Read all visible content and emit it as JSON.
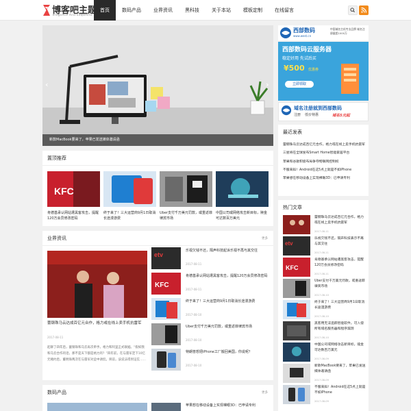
{
  "header": {
    "logo_text": "博客吧主题",
    "logo_sub": "Elegance And Exquisite",
    "nav": [
      "首页",
      "数码产品",
      "业界资讯",
      "黑科技",
      "关于本站",
      "模板定制",
      "在线留言"
    ],
    "active_nav_index": 0,
    "accent_color": "#e94141",
    "rss_color": "#f28b1b",
    "icons": [
      "search-icon",
      "rss-icon"
    ]
  },
  "slider": {
    "caption": "新款MacBook要来了，苹果已发送媒体邀请函",
    "prev": "‹",
    "next": "›"
  },
  "featured": {
    "title": "置顶推荐",
    "items": [
      "肯德基承认网站遭黑客攻击，提醒120万会员修改密码",
      "终于来了！三大运营商9月1日取消长途漫游费",
      "Uber支付千万美元罚款，或重返菲律宾市场",
      "中国公司或网络攻击新目标，赎金可达数百万美元"
    ]
  },
  "industry": {
    "title": "业界资讯",
    "more": "更多",
    "big": {
      "title": "蕾钢珠马云达成百亿元合作，格力或在线上卖手机抗雷军",
      "date": "2017-08-11",
      "excerpt": "起聊了四年后，蕾钢珠和马云再次牵手。格力和阿里正式联姻。“假如我和马云合作的话，那不是天下都是格力的？”四年前，在与雷军定下10亿元赌约后，董明珠两次在与雷军对垒中调侃。目前，该说法得到证实……"
    },
    "list": [
      {
        "title": "乐视欠钱不还，隔声科技起诉乐视不再与其交往",
        "date": "2017-08-11"
      },
      {
        "title": "肯德基承认网站遭黑客攻击，提醒120万会员修改密码",
        "date": "2017-08-11"
      },
      {
        "title": "终于来了！三大运营商9月1日取消长途漫游费",
        "date": "2017-08-10"
      },
      {
        "title": "Uber支付千万美元罚款，或重返菲律宾市场",
        "date": "2017-08-10"
      },
      {
        "title": "特朗普想把iPhone工厂搬回美国，你说呢？",
        "date": "2017-08-10"
      }
    ]
  },
  "digital": {
    "title": "数码产品",
    "more": "更多",
    "first_item": "苹果想在移动设备上实现裸眼3D：已申请专利"
  },
  "ads": {
    "ad1_brand": "西部数码",
    "ad1_url": "www.west.cn",
    "ad1_note": "中国域名主机专业品牌 域名注册量超1000万",
    "ad2_title": "西部数码云服务器",
    "ad2_slogan": "稳定好用 先试后买",
    "ad2_price": "¥500",
    "ad2_price_note": "优惠券",
    "ad2_button": "立即领取",
    "ad3_title": "域名注册就到西部数码",
    "ad3_sub": "注册",
    "ad3_price": "低价特惠",
    "ad3_promo": "域名5元起"
  },
  "latest": {
    "title": "最近发表",
    "items": [
      "蕾钢珠马云达成百亿元合作，格力或在线上卖手机抗雷军",
      "三星将在全球发布Smart Home智能家居平台",
      "苹果和谷歌积极布局争夺物联网控制权",
      "不服来辩！Android在这5点上就是不如iPhone",
      "苹果想在移动设备上实现裸眼3D：已申请专利"
    ]
  },
  "hot": {
    "title": "热门文章",
    "items": [
      {
        "title": "蕾钢珠马云达成百亿元合作，格力或在线上卖手机抗雷军",
        "date": "2017-08-11"
      },
      {
        "title": "乐视欠钱不还，隔声科技表示不再与其交往",
        "date": "2017-08-11"
      },
      {
        "title": "肯德基承认网站遭黑客攻击，提醒120万会员修改密码",
        "date": "2017-08-11"
      },
      {
        "title": "Uber支付千万美元罚款，或重返菲律宾市场",
        "date": "2017-08-10"
      },
      {
        "title": "终于来了！三大运营商9月1日取消长途漫游费",
        "date": "2017-08-10"
      },
      {
        "title": "黑客用无法追踪智能软件，可入侵所有域名服务器和程序漏洞",
        "date": "2017-08-10"
      },
      {
        "title": "中国公司或网络攻击新目标，赎金可达数百万美元",
        "date": "2017-08-09"
      },
      {
        "title": "新款MacBook要来了，苹果已发送媒体邀请函",
        "date": "2017-08-09"
      },
      {
        "title": "不服来辩！Android在这5点上就是不如iPhone",
        "date": "2017-08-09"
      }
    ]
  }
}
